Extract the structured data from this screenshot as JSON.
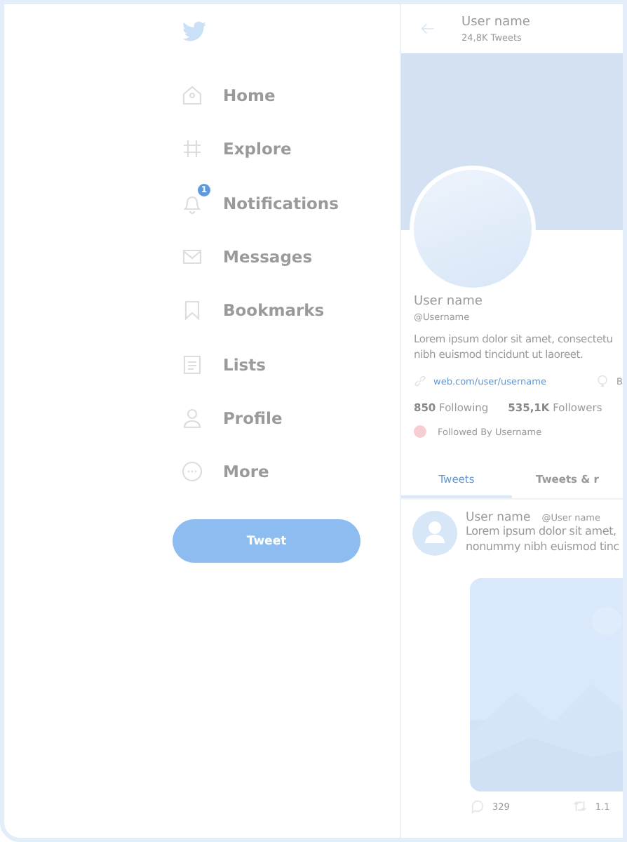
{
  "sidebar": {
    "items": [
      {
        "label": "Home"
      },
      {
        "label": "Explore"
      },
      {
        "label": "Notifications",
        "badge": "1"
      },
      {
        "label": "Messages"
      },
      {
        "label": "Bookmarks"
      },
      {
        "label": "Lists"
      },
      {
        "label": "Profile"
      },
      {
        "label": "More"
      }
    ],
    "tweet_button": "Tweet"
  },
  "header": {
    "name": "User name",
    "count": "24,8K Tweets"
  },
  "profile": {
    "name": "User name",
    "handle": "@Username",
    "bio": "Lorem ipsum dolor sit amet, consectetu",
    "bio_line2": "nibh euismod tincidunt ut laoreet.",
    "link": "web.com/user/username",
    "extra": "B",
    "following_count": "850",
    "following_label": "Following",
    "followers_count": "535,1K",
    "followers_label": "Followers",
    "followed_by": "Followed By Username"
  },
  "tabs": [
    {
      "label": "Tweets",
      "selected": true
    },
    {
      "label": "Tweets & r",
      "selected": false
    }
  ],
  "tweet": {
    "name": "User name",
    "handle": "@User name",
    "text": "Lorem ipsum dolor sit amet,",
    "text_line2": "nonummy nibh euismod tinc",
    "replies": "329",
    "retweets": "1.1"
  }
}
